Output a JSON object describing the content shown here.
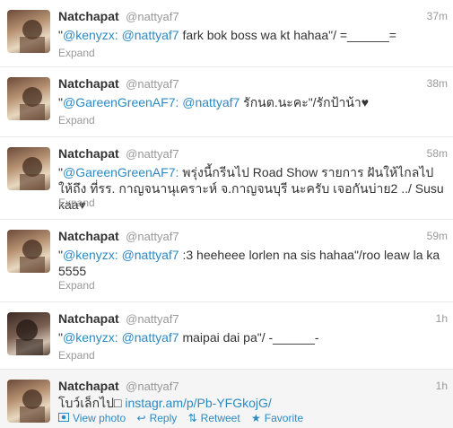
{
  "tweets": [
    {
      "fullname": "Natchapat",
      "username": "@nattyaf7",
      "time": "37m",
      "quote_open": "\"",
      "mention1": "@kenyzx:",
      "mention2": "@nattyaf7",
      "body": " fark bok boss wa kt hahaa\"/ =______=",
      "expand": "Expand"
    },
    {
      "fullname": "Natchapat",
      "username": "@nattyaf7",
      "time": "38m",
      "quote_open": "\"",
      "mention1": "@GareenGreenAF7:",
      "mention2": "@nattyaf7",
      "body": " รักนต.นะคะ\"/รักป้าน้า♥",
      "expand": "Expand"
    },
    {
      "fullname": "Natchapat",
      "username": "@nattyaf7",
      "time": "58m",
      "quote_open": "\"",
      "mention1": "@GareenGreenAF7:",
      "body": " พรุ่งนี้กรีนไป Road Show รายการ ฝันให้ไกลไปให้ถึง ที่รร. กาญจนานุเคราะห์ จ.กาญจนบุรี นะครับ เจอกันบ่าย2 ../ Susu kaa♥",
      "expand": "Expand"
    },
    {
      "fullname": "Natchapat",
      "username": "@nattyaf7",
      "time": "59m",
      "quote_open": "\"",
      "mention1": "@kenyzx:",
      "mention2": "@nattyaf7",
      "body": " :3 heeheee lorlen na sis hahaa\"/roo leaw la ka 5555",
      "expand": "Expand"
    },
    {
      "fullname": "Natchapat",
      "username": "@nattyaf7",
      "time": "1h",
      "quote_open": "\"",
      "mention1": "@kenyzx:",
      "mention2": "@nattyaf7",
      "body": " maipai dai pa\"/ -______-",
      "expand": "Expand"
    },
    {
      "fullname": "Natchapat",
      "username": "@nattyaf7",
      "time": "1h",
      "body_prefix": "โบว์เล็กไป□ ",
      "link": "instagr.am/p/Pb-YFGkojG/",
      "actions": {
        "view_photo": "View photo",
        "reply": "Reply",
        "retweet": "Retweet",
        "favorite": "Favorite"
      }
    }
  ],
  "colors": {
    "link": "#2b8ac4",
    "muted": "#999999",
    "text": "#333333",
    "hover_bg": "#f5f5f5"
  }
}
